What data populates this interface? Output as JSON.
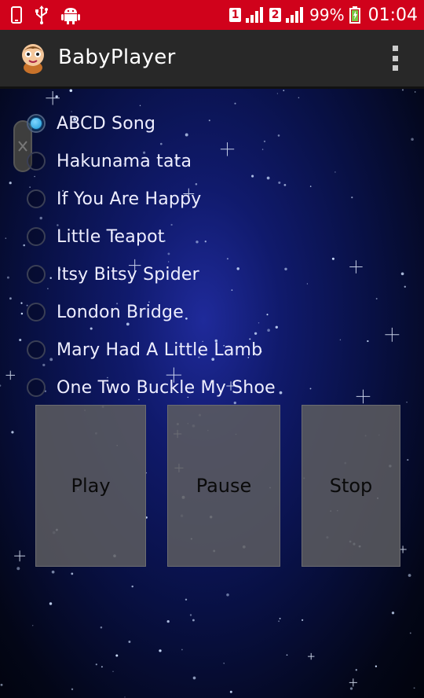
{
  "status_bar": {
    "battery_percent": "99%",
    "time": "01:04",
    "sim1": "1",
    "sim2": "2",
    "icons": [
      "phone-icon",
      "usb-icon",
      "android-icon",
      "signal-icon",
      "battery-charging-icon"
    ]
  },
  "action_bar": {
    "title": "BabyPlayer",
    "icon": "baby-face-icon",
    "overflow_icon": "overflow-menu-icon"
  },
  "songs": [
    {
      "label": "ABCD Song",
      "checked": true
    },
    {
      "label": "Hakunama tata",
      "checked": false
    },
    {
      "label": "If You Are Happy",
      "checked": false
    },
    {
      "label": "Little Teapot",
      "checked": false
    },
    {
      "label": "Itsy Bitsy Spider",
      "checked": false
    },
    {
      "label": "London Bridge",
      "checked": false
    },
    {
      "label": "Mary Had A Little Lamb",
      "checked": false
    },
    {
      "label": "One Two Buckle My Shoe",
      "checked": false
    }
  ],
  "controls": {
    "play_label": "Play",
    "pause_label": "Pause",
    "stop_label": "Stop"
  },
  "colors": {
    "status_bar": "#d0021b",
    "action_bar": "#282828",
    "radio_checked": "#27b3ff"
  }
}
